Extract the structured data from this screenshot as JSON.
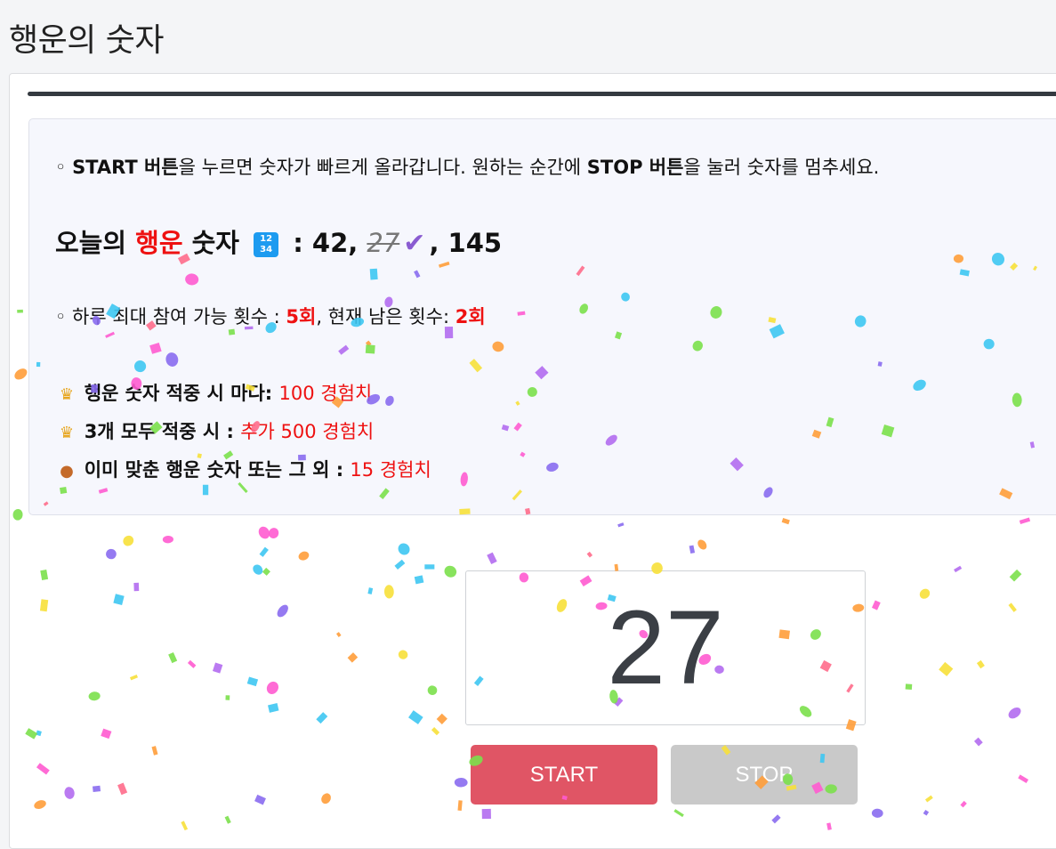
{
  "header": {
    "title": "행운의 숫자"
  },
  "info": {
    "instruction": {
      "bullet": "◦ ",
      "start_bold": "START 버튼",
      "text1": "을 누르면 숫자가 빠르게 올라갑니다. 원하는 순간에 ",
      "stop_bold": "STOP 버튼",
      "text2": "을 눌러 숫자를 멈추세요."
    },
    "lucky": {
      "prefix": "오늘의 ",
      "highlight": "행운",
      "suffix": " 숫자",
      "emoji_icon": "numbers-1234-emoji",
      "colon": " : ",
      "num1": "42, ",
      "num2": "27",
      "check_icon": "heavy-check-mark",
      "num3": ", 145"
    },
    "attempts": {
      "text1": "◦ 하루 최대 참여 가능 횟수 : ",
      "max": "5회",
      "text2": ", 현재 남은 횟수: ",
      "remaining": "2회"
    },
    "rewards": [
      {
        "icon": "crown-icon",
        "label": "행운 숫자 적중 시 마다: ",
        "value": "100 경험치"
      },
      {
        "icon": "crown-icon",
        "label": "3개 모두 적중 시 : ",
        "value": "추가 500 경험치"
      },
      {
        "icon": "medal-icon",
        "label": "이미 맞춘 행운 숫자 또는 그 외 : ",
        "value": "15 경험치"
      }
    ]
  },
  "game": {
    "display_number": "27",
    "start_label": "START",
    "stop_label": "STOP"
  },
  "colors": {
    "accent_red": "#ee1111",
    "start_button": "#e05565",
    "stop_button": "#c9c9c9",
    "top_rule": "#343a40"
  }
}
